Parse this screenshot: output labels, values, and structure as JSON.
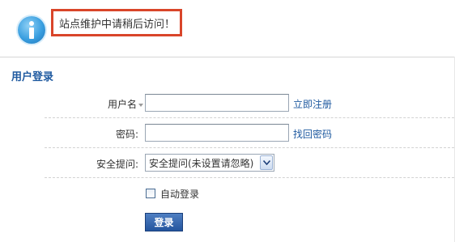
{
  "notice": {
    "message": "站点维护中请稍后访问！",
    "icon": "info-icon",
    "border_color": "#d9452a"
  },
  "login": {
    "section_title": "用户登录",
    "username_label": "用户名",
    "username_value": "",
    "register_link": "立即注册",
    "password_label": "密码:",
    "password_value": "",
    "forgot_link": "找回密码",
    "question_label": "安全提问:",
    "question_selected": "安全提问(未设置请忽略)",
    "auto_login_label": "自动登录",
    "auto_login_checked": false,
    "submit_label": "登录"
  },
  "colors": {
    "link": "#1f5aa0",
    "title": "#1f5aa0",
    "button": "#24559e"
  }
}
